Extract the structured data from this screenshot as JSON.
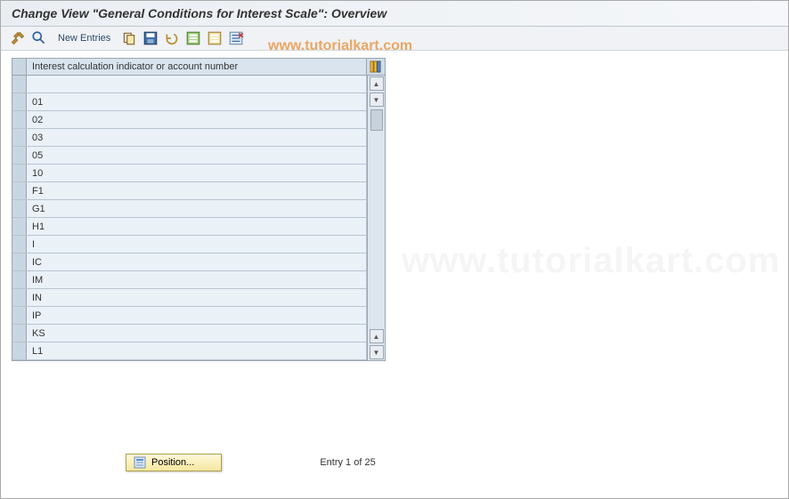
{
  "title": "Change View \"General Conditions for Interest Scale\": Overview",
  "toolbar": {
    "new_entries_label": "New Entries"
  },
  "watermark": "www.tutorialkart.com",
  "table": {
    "header": "Interest calculation indicator or account number",
    "rows": [
      "",
      "01",
      "02",
      "03",
      "05",
      "10",
      "F1",
      "G1",
      "H1",
      "I",
      "IC",
      "IM",
      "IN",
      "IP",
      "KS",
      "L1"
    ]
  },
  "footer": {
    "position_label": "Position...",
    "entry_text": "Entry 1 of 25"
  }
}
